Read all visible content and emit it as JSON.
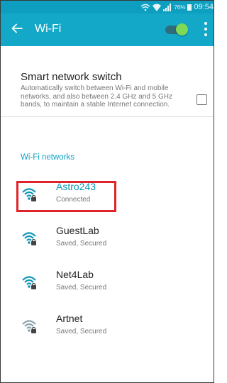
{
  "status_bar": {
    "battery_percent": "76%",
    "time": "09:54"
  },
  "appbar": {
    "title": "Wi-Fi",
    "wifi_enabled": true
  },
  "smart_switch": {
    "title": "Smart network switch",
    "description": "Automatically switch between Wi-Fi and mobile networks, and also between 2.4 GHz and 5 GHz bands, to maintain a stable Internet connection.",
    "checked": false
  },
  "section_label": "Wi-Fi networks",
  "networks": [
    {
      "name": "Astro243",
      "status": "Connected",
      "color": "#0f96b8"
    },
    {
      "name": "GuestLab",
      "status": "Saved, Secured",
      "color": "#0f96b8"
    },
    {
      "name": "Net4Lab",
      "status": "Saved, Secured",
      "color": "#0f96b8"
    },
    {
      "name": "Artnet",
      "status": "Saved, Secured",
      "color": "#8aa3ad"
    }
  ],
  "colors": {
    "status_bar": "#0d9ec0",
    "app_bar": "#14a8c8",
    "accent": "#14a3c4",
    "toggle_on": "#7ed957",
    "highlight": "#e0232a"
  }
}
